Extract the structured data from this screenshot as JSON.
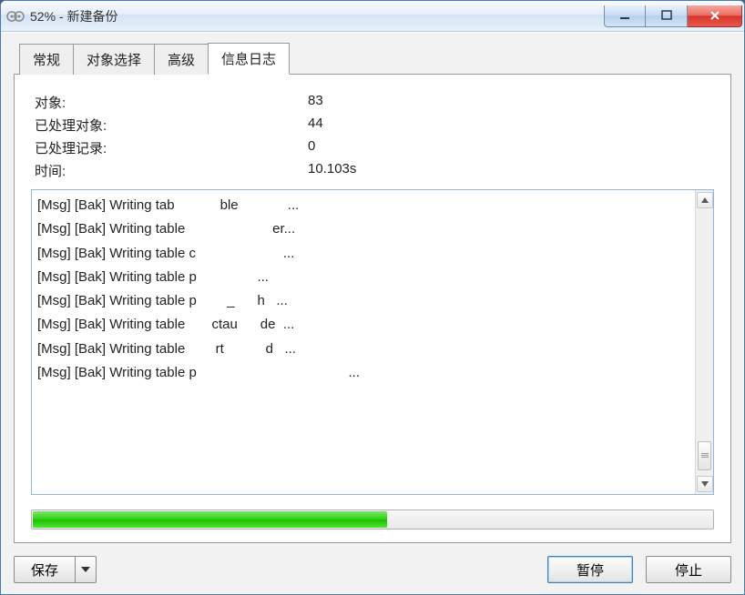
{
  "window": {
    "title": "52% - 新建备份"
  },
  "tabs": {
    "general": "常规",
    "objects": "对象选择",
    "advanced": "高级",
    "log": "信息日志"
  },
  "stats": {
    "objects_label": "对象:",
    "objects_value": "83",
    "processed_objects_label": "已处理对象:",
    "processed_objects_value": "44",
    "processed_records_label": "已处理记录:",
    "processed_records_value": "0",
    "time_label": "时间:",
    "time_value": "10.103s"
  },
  "log_lines": [
    "[Msg] [Bak] Writing tab            ble             ...",
    "[Msg] [Bak] Writing table                       er...",
    "[Msg] [Bak] Writing table c                       ...",
    "[Msg] [Bak] Writing table p                ...",
    "[Msg] [Bak] Writing table p        _      h   ...",
    "[Msg] [Bak] Writing table       ctau      de  ...",
    "[Msg] [Bak] Writing table        rt           d   ...",
    "[Msg] [Bak] Writing table p                                        ..."
  ],
  "progress_percent": 52,
  "buttons": {
    "save": "保存",
    "pause": "暂停",
    "stop": "停止"
  }
}
